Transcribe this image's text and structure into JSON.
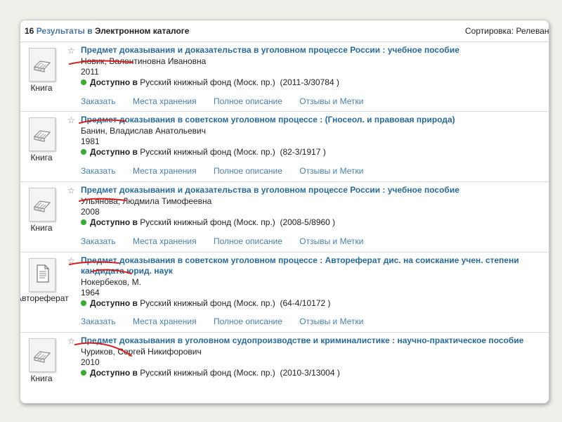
{
  "header": {
    "count": "16",
    "results_label": "Результаты",
    "in_label": "в",
    "catalog": "Электронном каталоге",
    "sort_label": "Сортировка:",
    "sort_value": "Релевантность"
  },
  "records": [
    {
      "type": "Книга",
      "title": "Предмет доказывания и доказательства в уголовном процессе России : учебное пособие",
      "author": "Новик, Валентиновна Ивановна",
      "year": "2011",
      "available_label": "Доступно в",
      "location": "Русский книжный фонд (Моск. пр.)",
      "shelfmark": "(2011-3/30784 )",
      "actions": [
        "Заказать",
        "Места хранения",
        "Полное описание",
        "Отзывы и Метки"
      ]
    },
    {
      "type": "Книга",
      "title": "Предмет доказывания в советском уголовном процессе : (Гносеол. и правовая природа)",
      "author": "Банин, Владислав Анатольевич",
      "year": "1981",
      "available_label": "Доступно в",
      "location": "Русский книжный фонд (Моск. пр.)",
      "shelfmark": "(82-3/1917 )",
      "actions": [
        "Заказать",
        "Места хранения",
        "Полное описание",
        "Отзывы и Метки"
      ]
    },
    {
      "type": "Книга",
      "title": "Предмет доказывания и доказательства в уголовном процессе России : учебное пособие",
      "author": "Ульянова, Людмила Тимофеевна",
      "year": "2008",
      "available_label": "Доступно в",
      "location": "Русский книжный фонд (Моск. пр.)",
      "shelfmark": "(2008-5/8960 )",
      "actions": [
        "Заказать",
        "Места хранения",
        "Полное описание",
        "Отзывы и Метки"
      ]
    },
    {
      "type": "Автореферат",
      "title": "Предмет доказывания в советском уголовном процессе : Автореферат дис. на соискание учен. степени кандидата юрид. наук",
      "author": "Нокербеков, М.",
      "year": "1964",
      "available_label": "Доступно в",
      "location": "Русский книжный фонд (Моск. пр.)",
      "shelfmark": "(64-4/10172 )",
      "actions": [
        "Заказать",
        "Места хранения",
        "Полное описание",
        "Отзывы и Метки"
      ]
    },
    {
      "type": "Книга",
      "title": "Предмет доказывания в уголовном судопроизводстве и криминалистике : научно-практическое пособие",
      "author": "Чуриков, Сергей Никифорович",
      "year": "2010",
      "available_label": "Доступно в",
      "location": "Русский книжный фонд (Моск. пр.)",
      "shelfmark": "(2010-3/13004 )",
      "actions": []
    }
  ],
  "colors": {
    "title": "#2a6a96",
    "action": "#4a7fa8",
    "available_dot": "#3aaa35",
    "annotation": "#d42020"
  }
}
